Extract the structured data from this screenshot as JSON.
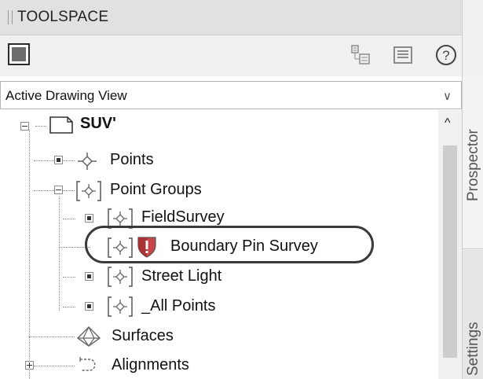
{
  "panel": {
    "title": "TOOLSPACE"
  },
  "side_tabs": {
    "tab1": "Prospector",
    "tab2": "Settings"
  },
  "toolbar": {
    "icons": [
      "view-cube-icon",
      "expand-tree-icon",
      "panel-icon",
      "help-icon"
    ],
    "help_label": "?"
  },
  "view_dropdown": {
    "value": "Active Drawing View",
    "chevron": "∨"
  },
  "scrollbar": {
    "up_arrow": "^"
  },
  "tree": {
    "root": "SUV'",
    "items": [
      {
        "label": "Points"
      },
      {
        "label": "Point Groups"
      },
      {
        "label": "FieldSurvey"
      },
      {
        "label": "Boundary Pin Survey"
      },
      {
        "label": "Street Light"
      },
      {
        "label": "_All Points"
      },
      {
        "label": "Surfaces"
      },
      {
        "label": "Alignments"
      }
    ]
  },
  "colors": {
    "header_bg": "#e1e1e1",
    "highlight_border": "#3a3a3a",
    "warning_shield": "#c8464a"
  }
}
